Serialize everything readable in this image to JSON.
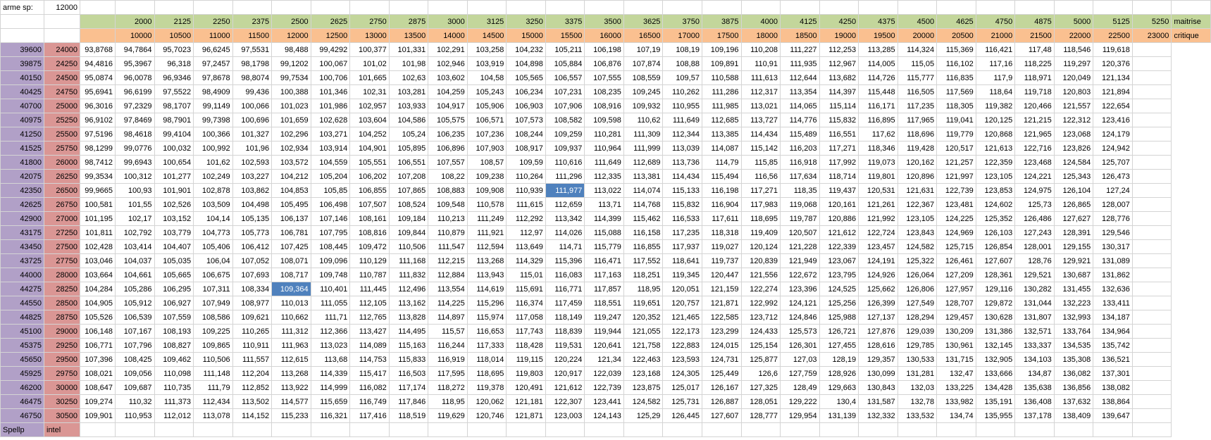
{
  "header": {
    "arme_label": "arme sp:",
    "arme_value": "12000",
    "maitrise_label": "maitrise",
    "critique_label": "critique"
  },
  "columns": {
    "maitrise": [
      "2000",
      "2125",
      "2250",
      "2375",
      "2500",
      "2625",
      "2750",
      "2875",
      "3000",
      "3125",
      "3250",
      "3375",
      "3500",
      "3625",
      "3750",
      "3875",
      "4000",
      "4125",
      "4250",
      "4375",
      "4500",
      "4625",
      "4750",
      "4875",
      "5000",
      "5125",
      "5250"
    ],
    "critique": [
      "10000",
      "10500",
      "11000",
      "11500",
      "12000",
      "12500",
      "13000",
      "13500",
      "14000",
      "14500",
      "15000",
      "15500",
      "16000",
      "16500",
      "17000",
      "17500",
      "18000",
      "18500",
      "19000",
      "19500",
      "20000",
      "20500",
      "21000",
      "21500",
      "22000",
      "22500",
      "23000"
    ]
  },
  "rows": [
    {
      "sp": "39600",
      "intel": "24000",
      "values": [
        "93,8768",
        "94,7864",
        "95,7023",
        "96,6245",
        "97,5531",
        "98,488",
        "99,4292",
        "100,377",
        "101,331",
        "102,291",
        "103,258",
        "104,232",
        "105,211",
        "106,198",
        "107,19",
        "108,19",
        "109,196",
        "110,208",
        "111,227",
        "112,253",
        "113,285",
        "114,324",
        "115,369",
        "116,421",
        "117,48",
        "118,546",
        "119,618"
      ]
    },
    {
      "sp": "39875",
      "intel": "24250",
      "values": [
        "94,4816",
        "95,3967",
        "96,318",
        "97,2457",
        "98,1798",
        "99,1202",
        "100,067",
        "101,02",
        "101,98",
        "102,946",
        "103,919",
        "104,898",
        "105,884",
        "106,876",
        "107,874",
        "108,88",
        "109,891",
        "110,91",
        "111,935",
        "112,967",
        "114,005",
        "115,05",
        "116,102",
        "117,16",
        "118,225",
        "119,297",
        "120,376"
      ]
    },
    {
      "sp": "40150",
      "intel": "24500",
      "values": [
        "95,0874",
        "96,0078",
        "96,9346",
        "97,8678",
        "98,8074",
        "99,7534",
        "100,706",
        "101,665",
        "102,63",
        "103,602",
        "104,58",
        "105,565",
        "106,557",
        "107,555",
        "108,559",
        "109,57",
        "110,588",
        "111,613",
        "112,644",
        "113,682",
        "114,726",
        "115,777",
        "116,835",
        "117,9",
        "118,971",
        "120,049",
        "121,134"
      ]
    },
    {
      "sp": "40425",
      "intel": "24750",
      "values": [
        "95,6941",
        "96,6199",
        "97,5522",
        "98,4909",
        "99,436",
        "100,388",
        "101,346",
        "102,31",
        "103,281",
        "104,259",
        "105,243",
        "106,234",
        "107,231",
        "108,235",
        "109,245",
        "110,262",
        "111,286",
        "112,317",
        "113,354",
        "114,397",
        "115,448",
        "116,505",
        "117,569",
        "118,64",
        "119,718",
        "120,803",
        "121,894"
      ]
    },
    {
      "sp": "40700",
      "intel": "25000",
      "values": [
        "96,3016",
        "97,2329",
        "98,1707",
        "99,1149",
        "100,066",
        "101,023",
        "101,986",
        "102,957",
        "103,933",
        "104,917",
        "105,906",
        "106,903",
        "107,906",
        "108,916",
        "109,932",
        "110,955",
        "111,985",
        "113,021",
        "114,065",
        "115,114",
        "116,171",
        "117,235",
        "118,305",
        "119,382",
        "120,466",
        "121,557",
        "122,654"
      ]
    },
    {
      "sp": "40975",
      "intel": "25250",
      "values": [
        "96,9102",
        "97,8469",
        "98,7901",
        "99,7398",
        "100,696",
        "101,659",
        "102,628",
        "103,604",
        "104,586",
        "105,575",
        "106,571",
        "107,573",
        "108,582",
        "109,598",
        "110,62",
        "111,649",
        "112,685",
        "113,727",
        "114,776",
        "115,832",
        "116,895",
        "117,965",
        "119,041",
        "120,125",
        "121,215",
        "122,312",
        "123,416"
      ]
    },
    {
      "sp": "41250",
      "intel": "25500",
      "values": [
        "97,5196",
        "98,4618",
        "99,4104",
        "100,366",
        "101,327",
        "102,296",
        "103,271",
        "104,252",
        "105,24",
        "106,235",
        "107,236",
        "108,244",
        "109,259",
        "110,281",
        "111,309",
        "112,344",
        "113,385",
        "114,434",
        "115,489",
        "116,551",
        "117,62",
        "118,696",
        "119,779",
        "120,868",
        "121,965",
        "123,068",
        "124,179"
      ]
    },
    {
      "sp": "41525",
      "intel": "25750",
      "values": [
        "98,1299",
        "99,0776",
        "100,032",
        "100,992",
        "101,96",
        "102,934",
        "103,914",
        "104,901",
        "105,895",
        "106,896",
        "107,903",
        "108,917",
        "109,937",
        "110,964",
        "111,999",
        "113,039",
        "114,087",
        "115,142",
        "116,203",
        "117,271",
        "118,346",
        "119,428",
        "120,517",
        "121,613",
        "122,716",
        "123,826",
        "124,942"
      ]
    },
    {
      "sp": "41800",
      "intel": "26000",
      "values": [
        "98,7412",
        "99,6943",
        "100,654",
        "101,62",
        "102,593",
        "103,572",
        "104,559",
        "105,551",
        "106,551",
        "107,557",
        "108,57",
        "109,59",
        "110,616",
        "111,649",
        "112,689",
        "113,736",
        "114,79",
        "115,85",
        "116,918",
        "117,992",
        "119,073",
        "120,162",
        "121,257",
        "122,359",
        "123,468",
        "124,584",
        "125,707"
      ]
    },
    {
      "sp": "42075",
      "intel": "26250",
      "values": [
        "99,3534",
        "100,312",
        "101,277",
        "102,249",
        "103,227",
        "104,212",
        "105,204",
        "106,202",
        "107,208",
        "108,22",
        "109,238",
        "110,264",
        "111,296",
        "112,335",
        "113,381",
        "114,434",
        "115,494",
        "116,56",
        "117,634",
        "118,714",
        "119,801",
        "120,896",
        "121,997",
        "123,105",
        "124,221",
        "125,343",
        "126,473"
      ]
    },
    {
      "sp": "42350",
      "intel": "26500",
      "values": [
        "99,9665",
        "100,93",
        "101,901",
        "102,878",
        "103,862",
        "104,853",
        "105,85",
        "106,855",
        "107,865",
        "108,883",
        "109,908",
        "110,939",
        "111,977",
        "113,022",
        "114,074",
        "115,133",
        "116,198",
        "117,271",
        "118,35",
        "119,437",
        "120,531",
        "121,631",
        "122,739",
        "123,853",
        "124,975",
        "126,104",
        "127,24"
      ]
    },
    {
      "sp": "42625",
      "intel": "26750",
      "values": [
        "100,581",
        "101,55",
        "102,526",
        "103,509",
        "104,498",
        "105,495",
        "106,498",
        "107,507",
        "108,524",
        "109,548",
        "110,578",
        "111,615",
        "112,659",
        "113,71",
        "114,768",
        "115,832",
        "116,904",
        "117,983",
        "119,068",
        "120,161",
        "121,261",
        "122,367",
        "123,481",
        "124,602",
        "125,73",
        "126,865",
        "128,007"
      ]
    },
    {
      "sp": "42900",
      "intel": "27000",
      "values": [
        "101,195",
        "102,17",
        "103,152",
        "104,14",
        "105,135",
        "106,137",
        "107,146",
        "108,161",
        "109,184",
        "110,213",
        "111,249",
        "112,292",
        "113,342",
        "114,399",
        "115,462",
        "116,533",
        "117,611",
        "118,695",
        "119,787",
        "120,886",
        "121,992",
        "123,105",
        "124,225",
        "125,352",
        "126,486",
        "127,627",
        "128,776"
      ]
    },
    {
      "sp": "43175",
      "intel": "27250",
      "values": [
        "101,811",
        "102,792",
        "103,779",
        "104,773",
        "105,773",
        "106,781",
        "107,795",
        "108,816",
        "109,844",
        "110,879",
        "111,921",
        "112,97",
        "114,026",
        "115,088",
        "116,158",
        "117,235",
        "118,318",
        "119,409",
        "120,507",
        "121,612",
        "122,724",
        "123,843",
        "124,969",
        "126,103",
        "127,243",
        "128,391",
        "129,546"
      ]
    },
    {
      "sp": "43450",
      "intel": "27500",
      "values": [
        "102,428",
        "103,414",
        "104,407",
        "105,406",
        "106,412",
        "107,425",
        "108,445",
        "109,472",
        "110,506",
        "111,547",
        "112,594",
        "113,649",
        "114,71",
        "115,779",
        "116,855",
        "117,937",
        "119,027",
        "120,124",
        "121,228",
        "122,339",
        "123,457",
        "124,582",
        "125,715",
        "126,854",
        "128,001",
        "129,155",
        "130,317"
      ]
    },
    {
      "sp": "43725",
      "intel": "27750",
      "values": [
        "103,046",
        "104,037",
        "105,035",
        "106,04",
        "107,052",
        "108,071",
        "109,096",
        "110,129",
        "111,168",
        "112,215",
        "113,268",
        "114,329",
        "115,396",
        "116,471",
        "117,552",
        "118,641",
        "119,737",
        "120,839",
        "121,949",
        "123,067",
        "124,191",
        "125,322",
        "126,461",
        "127,607",
        "128,76",
        "129,921",
        "131,089"
      ]
    },
    {
      "sp": "44000",
      "intel": "28000",
      "values": [
        "103,664",
        "104,661",
        "105,665",
        "106,675",
        "107,693",
        "108,717",
        "109,748",
        "110,787",
        "111,832",
        "112,884",
        "113,943",
        "115,01",
        "116,083",
        "117,163",
        "118,251",
        "119,345",
        "120,447",
        "121,556",
        "122,672",
        "123,795",
        "124,926",
        "126,064",
        "127,209",
        "128,361",
        "129,521",
        "130,687",
        "131,862"
      ]
    },
    {
      "sp": "44275",
      "intel": "28250",
      "values": [
        "104,284",
        "105,286",
        "106,295",
        "107,311",
        "108,334",
        "109,364",
        "110,401",
        "111,445",
        "112,496",
        "113,554",
        "114,619",
        "115,691",
        "116,771",
        "117,857",
        "118,95",
        "120,051",
        "121,159",
        "122,274",
        "123,396",
        "124,525",
        "125,662",
        "126,806",
        "127,957",
        "129,116",
        "130,282",
        "131,455",
        "132,636"
      ]
    },
    {
      "sp": "44550",
      "intel": "28500",
      "values": [
        "104,905",
        "105,912",
        "106,927",
        "107,949",
        "108,977",
        "110,013",
        "111,055",
        "112,105",
        "113,162",
        "114,225",
        "115,296",
        "116,374",
        "117,459",
        "118,551",
        "119,651",
        "120,757",
        "121,871",
        "122,992",
        "124,121",
        "125,256",
        "126,399",
        "127,549",
        "128,707",
        "129,872",
        "131,044",
        "132,223",
        "133,411"
      ]
    },
    {
      "sp": "44825",
      "intel": "28750",
      "values": [
        "105,526",
        "106,539",
        "107,559",
        "108,586",
        "109,621",
        "110,662",
        "111,71",
        "112,765",
        "113,828",
        "114,897",
        "115,974",
        "117,058",
        "118,149",
        "119,247",
        "120,352",
        "121,465",
        "122,585",
        "123,712",
        "124,846",
        "125,988",
        "127,137",
        "128,294",
        "129,457",
        "130,628",
        "131,807",
        "132,993",
        "134,187"
      ]
    },
    {
      "sp": "45100",
      "intel": "29000",
      "values": [
        "106,148",
        "107,167",
        "108,193",
        "109,225",
        "110,265",
        "111,312",
        "112,366",
        "113,427",
        "114,495",
        "115,57",
        "116,653",
        "117,743",
        "118,839",
        "119,944",
        "121,055",
        "122,173",
        "123,299",
        "124,433",
        "125,573",
        "126,721",
        "127,876",
        "129,039",
        "130,209",
        "131,386",
        "132,571",
        "133,764",
        "134,964"
      ]
    },
    {
      "sp": "45375",
      "intel": "29250",
      "values": [
        "106,771",
        "107,796",
        "108,827",
        "109,865",
        "110,911",
        "111,963",
        "113,023",
        "114,089",
        "115,163",
        "116,244",
        "117,333",
        "118,428",
        "119,531",
        "120,641",
        "121,758",
        "122,883",
        "124,015",
        "125,154",
        "126,301",
        "127,455",
        "128,616",
        "129,785",
        "130,961",
        "132,145",
        "133,337",
        "134,535",
        "135,742"
      ]
    },
    {
      "sp": "45650",
      "intel": "29500",
      "values": [
        "107,396",
        "108,425",
        "109,462",
        "110,506",
        "111,557",
        "112,615",
        "113,68",
        "114,753",
        "115,833",
        "116,919",
        "118,014",
        "119,115",
        "120,224",
        "121,34",
        "122,463",
        "123,593",
        "124,731",
        "125,877",
        "127,03",
        "128,19",
        "129,357",
        "130,533",
        "131,715",
        "132,905",
        "134,103",
        "135,308",
        "136,521"
      ]
    },
    {
      "sp": "45925",
      "intel": "29750",
      "values": [
        "108,021",
        "109,056",
        "110,098",
        "111,148",
        "112,204",
        "113,268",
        "114,339",
        "115,417",
        "116,503",
        "117,595",
        "118,695",
        "119,803",
        "120,917",
        "122,039",
        "123,168",
        "124,305",
        "125,449",
        "126,6",
        "127,759",
        "128,926",
        "130,099",
        "131,281",
        "132,47",
        "133,666",
        "134,87",
        "136,082",
        "137,301"
      ]
    },
    {
      "sp": "46200",
      "intel": "30000",
      "values": [
        "108,647",
        "109,687",
        "110,735",
        "111,79",
        "112,852",
        "113,922",
        "114,999",
        "116,082",
        "117,174",
        "118,272",
        "119,378",
        "120,491",
        "121,612",
        "122,739",
        "123,875",
        "125,017",
        "126,167",
        "127,325",
        "128,49",
        "129,663",
        "130,843",
        "132,03",
        "133,225",
        "134,428",
        "135,638",
        "136,856",
        "138,082"
      ]
    },
    {
      "sp": "46475",
      "intel": "30250",
      "values": [
        "109,274",
        "110,32",
        "111,373",
        "112,434",
        "113,502",
        "114,577",
        "115,659",
        "116,749",
        "117,846",
        "118,95",
        "120,062",
        "121,181",
        "122,307",
        "123,441",
        "124,582",
        "125,731",
        "126,887",
        "128,051",
        "129,222",
        "130,4",
        "131,587",
        "132,78",
        "133,982",
        "135,191",
        "136,408",
        "137,632",
        "138,864"
      ]
    },
    {
      "sp": "46750",
      "intel": "30500",
      "values": [
        "109,901",
        "110,953",
        "112,012",
        "113,078",
        "114,152",
        "115,233",
        "116,321",
        "117,416",
        "118,519",
        "119,629",
        "120,746",
        "121,871",
        "123,003",
        "124,143",
        "125,29",
        "126,445",
        "127,607",
        "128,777",
        "129,954",
        "131,139",
        "132,332",
        "133,532",
        "134,74",
        "135,955",
        "137,178",
        "138,409",
        "139,647"
      ]
    }
  ],
  "footer": {
    "sp_label": "Spellp",
    "intel_label": "intel"
  },
  "selected": [
    {
      "row": 10,
      "col": 12,
      "value": "111,977"
    },
    {
      "row": 17,
      "col": 5,
      "value": "109,364"
    }
  ],
  "colors": {
    "maitrise_header": "#c3d69b",
    "critique_header": "#fac090",
    "sp_column": "#b1a0c7",
    "intel_column": "#da9694",
    "selection": "#4f81bd",
    "gridline": "#d4d4d4"
  }
}
